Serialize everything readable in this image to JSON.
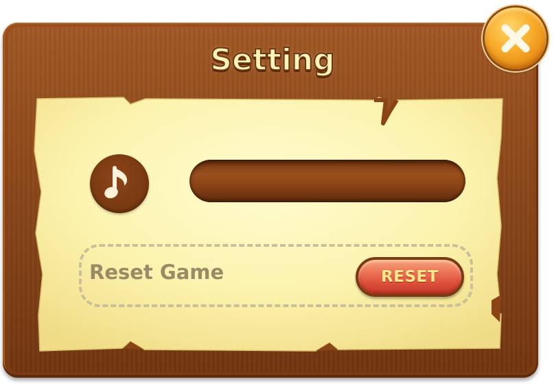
{
  "dialog": {
    "title": "Setting"
  },
  "music": {
    "icon": "music-note-icon",
    "volume_level": 0
  },
  "reset": {
    "label": "Reset Game",
    "button_label": "RESET"
  },
  "close": {
    "icon": "close-x-icon"
  },
  "colors": {
    "frame": "#8a4416",
    "parchment": "#fdf7b8",
    "title_fill": "#fff4b8",
    "close_button": "#f7a928",
    "reset_button": "#dc4e3a",
    "reset_text": "#ffe88a"
  }
}
